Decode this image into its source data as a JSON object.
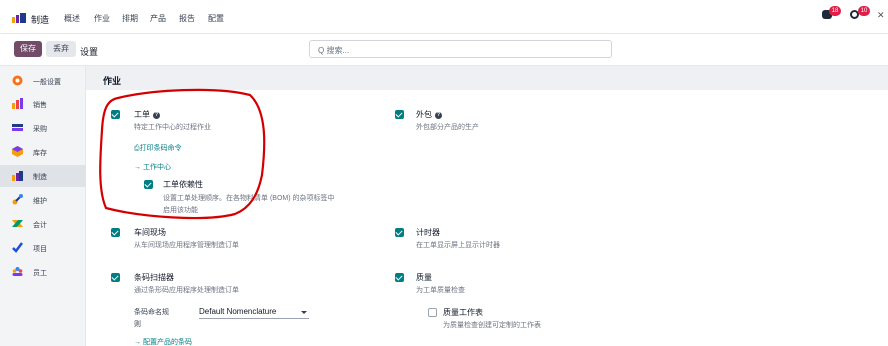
{
  "nav": {
    "brand": "制造",
    "menu": [
      "概述",
      "作业",
      "排期",
      "产品",
      "报告",
      "配置"
    ],
    "messages_count": "18",
    "activities_count": "10"
  },
  "control_panel": {
    "save": "保存",
    "discard": "丢弃",
    "title": "设置",
    "search_placeholder": "Q 搜索..."
  },
  "sidebar": {
    "items": [
      {
        "label": "一般设置",
        "icon": "general-settings-icon"
      },
      {
        "label": "销售",
        "icon": "sales-icon"
      },
      {
        "label": "采购",
        "icon": "purchase-icon"
      },
      {
        "label": "库存",
        "icon": "inventory-icon"
      },
      {
        "label": "制造",
        "icon": "manufacturing-icon",
        "active": true
      },
      {
        "label": "维护",
        "icon": "maintenance-icon"
      },
      {
        "label": "会计",
        "icon": "accounting-icon"
      },
      {
        "label": "项目",
        "icon": "project-icon"
      },
      {
        "label": "员工",
        "icon": "employees-icon"
      }
    ]
  },
  "section": {
    "title": "作业"
  },
  "settings": {
    "workorders": {
      "title": "工单",
      "desc": "特定工作中心的过程作业",
      "checked": true
    },
    "print_barcode_link": "⎙打印条码命令",
    "workcenter_link": "→ 工作中心",
    "workorder_dependencies": {
      "title": "工单依赖性",
      "desc_line1": "设置工单处理顺序。在各物料清单 (BOM) 的杂项标签中",
      "desc_line2": "启用该功能",
      "checked": true
    },
    "subcontracting": {
      "title": "外包",
      "desc": "外包部分产品的生产",
      "checked": true
    },
    "shopfloor": {
      "title": "车间现场",
      "desc": "从车间现场应用程序管理制造订单",
      "checked": true
    },
    "timer": {
      "title": "计时器",
      "desc": "在工单显示屏上显示计时器",
      "checked": true
    },
    "barcode_scanner": {
      "title": "条码扫描器",
      "desc": "通过条形码应用程序处理制造订单",
      "checked": true
    },
    "nomenclature_label_1": "条码命名规",
    "nomenclature_label_2": "则",
    "nomenclature_value": "Default Nomenclature",
    "configure_barcodes_link": "→ 配置产品的条码",
    "quality": {
      "title": "质量",
      "desc": "为工单质量检查",
      "checked": true
    },
    "quality_worksheet": {
      "title": "质量工作表",
      "desc": "为质量检查创建可定制的工作表",
      "checked": false
    }
  },
  "colors": {
    "primary": "#714b67",
    "teal": "#017e84",
    "annotation": "#d40000"
  }
}
